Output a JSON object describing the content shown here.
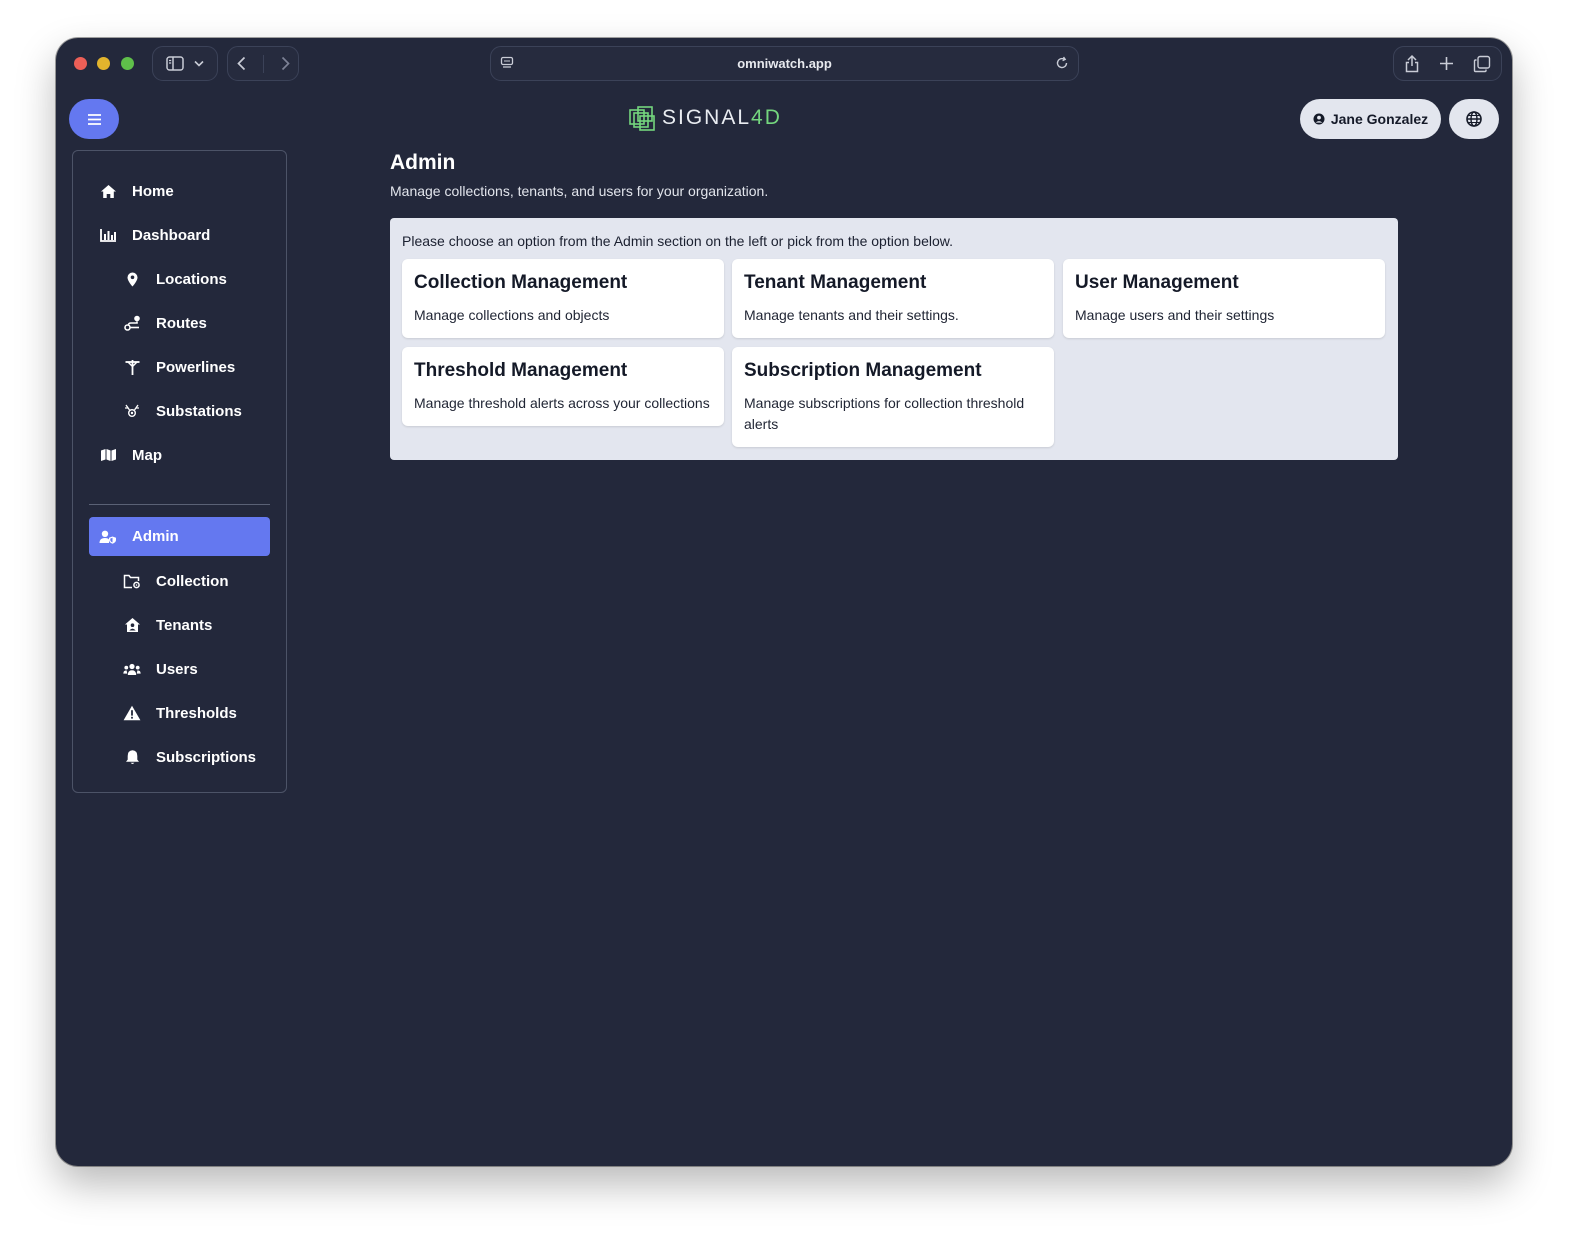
{
  "browser": {
    "url": "omniwatch.app"
  },
  "header": {
    "logo_main": "SIGNAL",
    "logo_accent": "4D",
    "user_name": "Jane Gonzalez"
  },
  "sidebar": {
    "items": [
      {
        "label": "Home",
        "icon": "home-icon"
      },
      {
        "label": "Dashboard",
        "icon": "bar-chart-icon"
      },
      {
        "label": "Locations",
        "icon": "map-pin-icon"
      },
      {
        "label": "Routes",
        "icon": "route-icon"
      },
      {
        "label": "Powerlines",
        "icon": "powerline-icon"
      },
      {
        "label": "Substations",
        "icon": "substation-icon"
      },
      {
        "label": "Map",
        "icon": "map-icon"
      },
      {
        "label": "Admin",
        "icon": "user-shield-icon",
        "active": true
      },
      {
        "label": "Collection",
        "icon": "folder-gear-icon"
      },
      {
        "label": "Tenants",
        "icon": "house-user-icon"
      },
      {
        "label": "Users",
        "icon": "users-icon"
      },
      {
        "label": "Thresholds",
        "icon": "warning-icon"
      },
      {
        "label": "Subscriptions",
        "icon": "bell-icon"
      }
    ]
  },
  "main": {
    "title": "Admin",
    "subtitle": "Manage collections, tenants, and users for your organization.",
    "intro": "Please choose an option from the Admin section on the left or pick from the option below.",
    "cards": [
      {
        "title": "Collection Management",
        "description": "Manage collections and objects"
      },
      {
        "title": "Tenant Management",
        "description": "Manage tenants and their settings."
      },
      {
        "title": "User Management",
        "description": "Manage users and their settings"
      },
      {
        "title": "Threshold Management",
        "description": "Manage threshold alerts across your collections"
      },
      {
        "title": "Subscription Management",
        "description": "Manage subscriptions for collection threshold alerts"
      }
    ]
  },
  "colors": {
    "window_bg": "#23283b",
    "accent": "#6478f0",
    "logo_accent": "#74d67e",
    "panel_bg": "#e3e6ef"
  }
}
